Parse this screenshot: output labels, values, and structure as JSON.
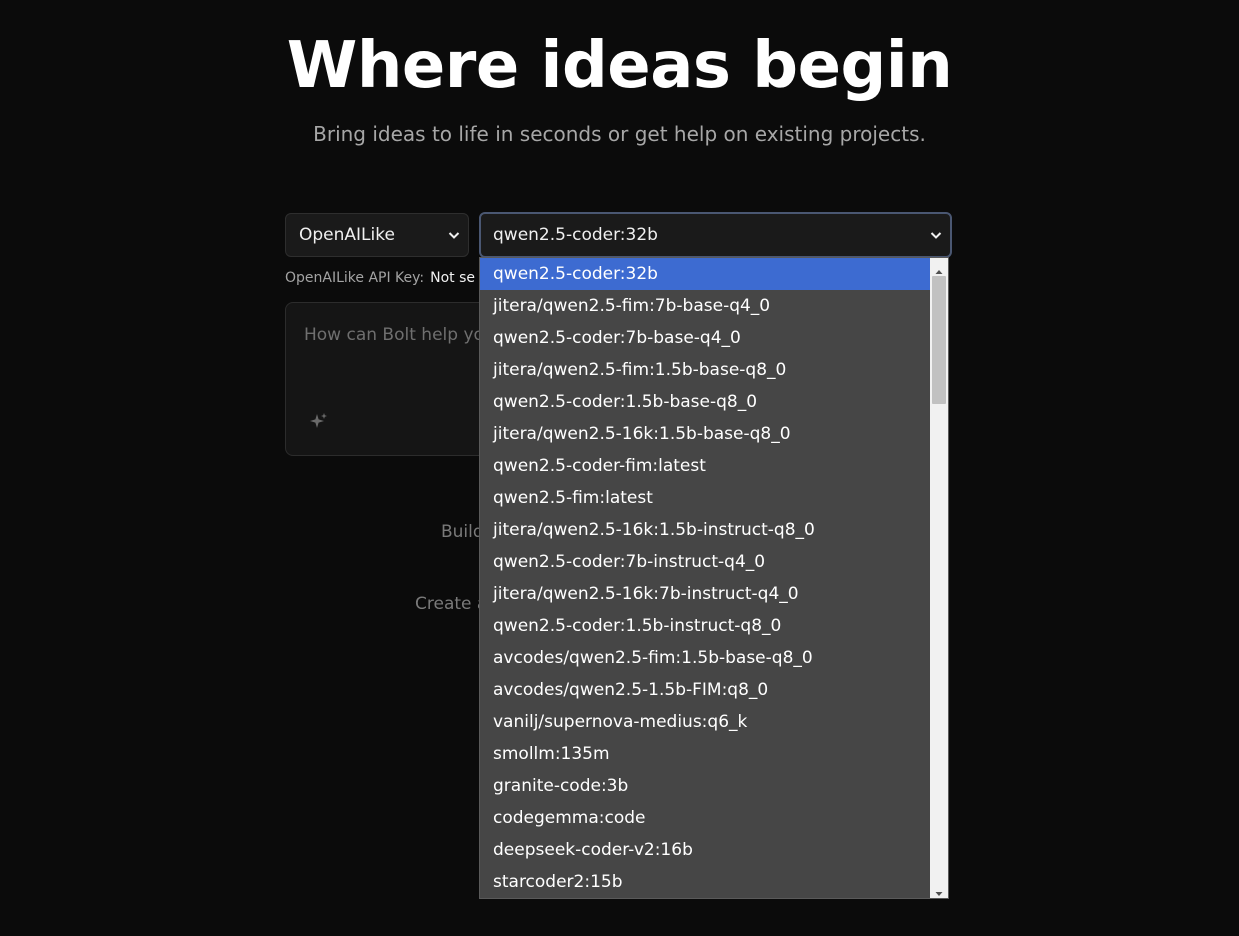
{
  "hero": {
    "title": "Where ideas begin",
    "subtitle": "Bring ideas to life in seconds or get help on existing projects."
  },
  "provider_select": {
    "value": "OpenAILike"
  },
  "model_select": {
    "value": "qwen2.5-coder:32b"
  },
  "api_key": {
    "label": "OpenAILike API Key:",
    "value_visible": "Not se"
  },
  "prompt": {
    "placeholder_visible": "How can Bolt help you"
  },
  "background_text": {
    "line1": "Build",
    "line2": "Create a"
  },
  "dropdown": {
    "options": [
      "qwen2.5-coder:32b",
      "jitera/qwen2.5-fim:7b-base-q4_0",
      "qwen2.5-coder:7b-base-q4_0",
      "jitera/qwen2.5-fim:1.5b-base-q8_0",
      "qwen2.5-coder:1.5b-base-q8_0",
      "jitera/qwen2.5-16k:1.5b-base-q8_0",
      "qwen2.5-coder-fim:latest",
      "qwen2.5-fim:latest",
      "jitera/qwen2.5-16k:1.5b-instruct-q8_0",
      "qwen2.5-coder:7b-instruct-q4_0",
      "jitera/qwen2.5-16k:7b-instruct-q4_0",
      "qwen2.5-coder:1.5b-instruct-q8_0",
      "avcodes/qwen2.5-fim:1.5b-base-q8_0",
      "avcodes/qwen2.5-1.5b-FIM:q8_0",
      "vanilj/supernova-medius:q6_k",
      "smollm:135m",
      "granite-code:3b",
      "codegemma:code",
      "deepseek-coder-v2:16b",
      "starcoder2:15b"
    ],
    "selected_option": "qwen2.5-coder:32b"
  },
  "colors": {
    "background": "#0b0b0b",
    "selected_option": "#3d6bd1",
    "dropdown_bg": "#464646"
  }
}
